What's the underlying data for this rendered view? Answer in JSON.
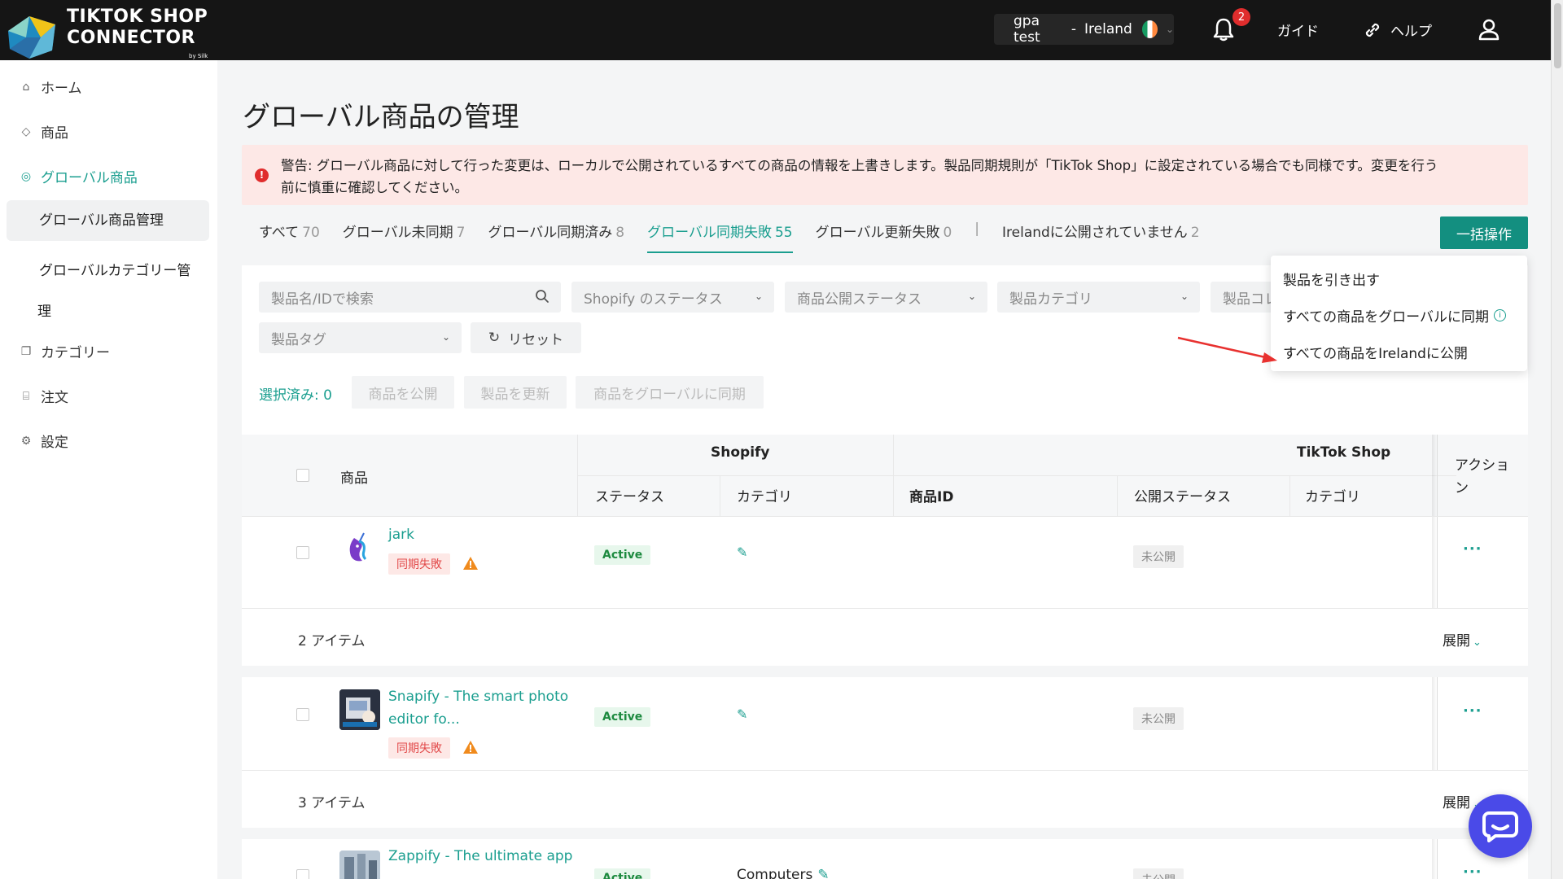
{
  "header": {
    "logo": {
      "line1": "TIKTOK SHOP",
      "line2": "CONNECTOR",
      "line3": "by Silk"
    },
    "store": {
      "name": "gpa test",
      "separator": "-",
      "country": "Ireland"
    },
    "notifications": {
      "count": "2"
    },
    "guide_label": "ガイド",
    "help_label": "ヘルプ"
  },
  "sidebar": {
    "items": [
      {
        "label": "ホーム",
        "icon": "home-icon"
      },
      {
        "label": "商品",
        "icon": "tag-icon"
      },
      {
        "label": "グローバル商品",
        "icon": "globe-icon"
      },
      {
        "label": "カテゴリー",
        "icon": "copy-icon"
      },
      {
        "label": "注文",
        "icon": "inbox-icon"
      },
      {
        "label": "設定",
        "icon": "gear-icon"
      }
    ],
    "sub_items": [
      {
        "label": "グローバル商品管理"
      },
      {
        "label": "グローバルカテゴリー管",
        "label2": "理"
      }
    ]
  },
  "page": {
    "title": "グローバル商品の管理",
    "alert": {
      "line1": "警告: グローバル商品に対して行った変更は、ローカルで公開されているすべての商品の情報を上書きします。製品同期規則が「TikTok Shop」に設定されている場合でも同様です。変更を行う",
      "line2": "前に慎重に確認してください。"
    },
    "tabs": [
      {
        "label": "すべて",
        "count": "70"
      },
      {
        "label": "グローバル未同期",
        "count": "7"
      },
      {
        "label": "グローバル同期済み",
        "count": "8"
      },
      {
        "label": "グローバル同期失敗",
        "count": "55"
      },
      {
        "label": "グローバル更新失敗",
        "count": "0"
      },
      {
        "label": "Irelandに公開されていません",
        "count": "2"
      }
    ],
    "tab_separator": "|",
    "bulk_button": "一括操作",
    "bulk_menu": [
      {
        "label": "製品を引き出す"
      },
      {
        "label": "すべての商品をグローバルに同期"
      },
      {
        "label": "すべての商品をIrelandに公開"
      }
    ]
  },
  "filters": {
    "search_placeholder": "製品名/IDで検索",
    "shopify_status": "Shopify のステータス",
    "publish_status": "商品公開ステータス",
    "product_category": "製品カテゴリ",
    "product_collection": "製品コレ",
    "product_tag": "製品タグ",
    "reset": "リセット",
    "selected": "選択済み: 0",
    "publish_btn": "商品を公開",
    "update_btn": "製品を更新",
    "sync_btn": "商品をグローバルに同期"
  },
  "table": {
    "headers": {
      "product": "商品",
      "shopify": "Shopify",
      "tiktok": "TikTok Shop",
      "status": "ステータス",
      "category": "カテゴリ",
      "product_id": "商品ID",
      "publish_status": "公開ステータス",
      "tt_category": "カテゴリ",
      "action1": "アクショ",
      "action2": "ン"
    },
    "rows": [
      {
        "name": "jark",
        "name2": "",
        "sync": "同期失敗",
        "status": "Active",
        "category": "",
        "publish": "未公開",
        "actions": "···"
      },
      {
        "name": "Snapify - The smart photo",
        "name2": "editor fo...",
        "sync": "同期失敗",
        "status": "Active",
        "category": "",
        "publish": "未公開",
        "actions": "···"
      },
      {
        "name": "Zappify - The ultimate app",
        "name2": "",
        "sync": "",
        "status": "Active",
        "category": "Computers",
        "publish": "未公開",
        "actions": "···"
      }
    ],
    "groups": [
      {
        "label": "2 アイテム",
        "expand": "展開"
      },
      {
        "label": "3 アイテム",
        "expand": "展開"
      }
    ]
  },
  "colors": {
    "accent": "#1a9e8f",
    "header_bg": "#151515",
    "alert_bg": "#fde8e6",
    "chat": "#4a4ae8"
  }
}
